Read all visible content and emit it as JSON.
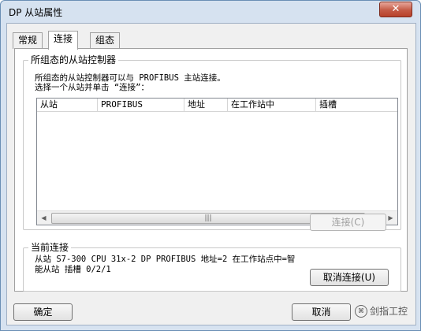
{
  "window": {
    "title": "DP 从站属性",
    "close_glyph": "✕"
  },
  "tabs": [
    {
      "label": "常规"
    },
    {
      "label": "连接"
    },
    {
      "label": "组态"
    }
  ],
  "slave_group": {
    "label": "所组态的从站控制器",
    "line1": "所组态的从站控制器可以与 PROFIBUS 主站连接。",
    "line2": "选择一个从站并单击 “连接”："
  },
  "table": {
    "columns": [
      "从站",
      "PROFIBUS",
      "地址",
      "在工作站中",
      "插槽"
    ],
    "rows": []
  },
  "scrollbar": {
    "left_arrow": "◀",
    "right_arrow": "▶",
    "grip": "|||"
  },
  "connect_button": {
    "label": "连接(C)"
  },
  "current_group": {
    "label": "当前连接",
    "line1": "从站 S7-300 CPU 31x-2 DP PROFIBUS 地址=2 在工作站点中=智",
    "line2": "能从站 插槽 0/2/1"
  },
  "disconnect_button": {
    "label": "取消连接(U)"
  },
  "footer": {
    "ok_label": "确定",
    "cancel_label": "取消"
  },
  "watermark": {
    "text": "剑指工控"
  }
}
